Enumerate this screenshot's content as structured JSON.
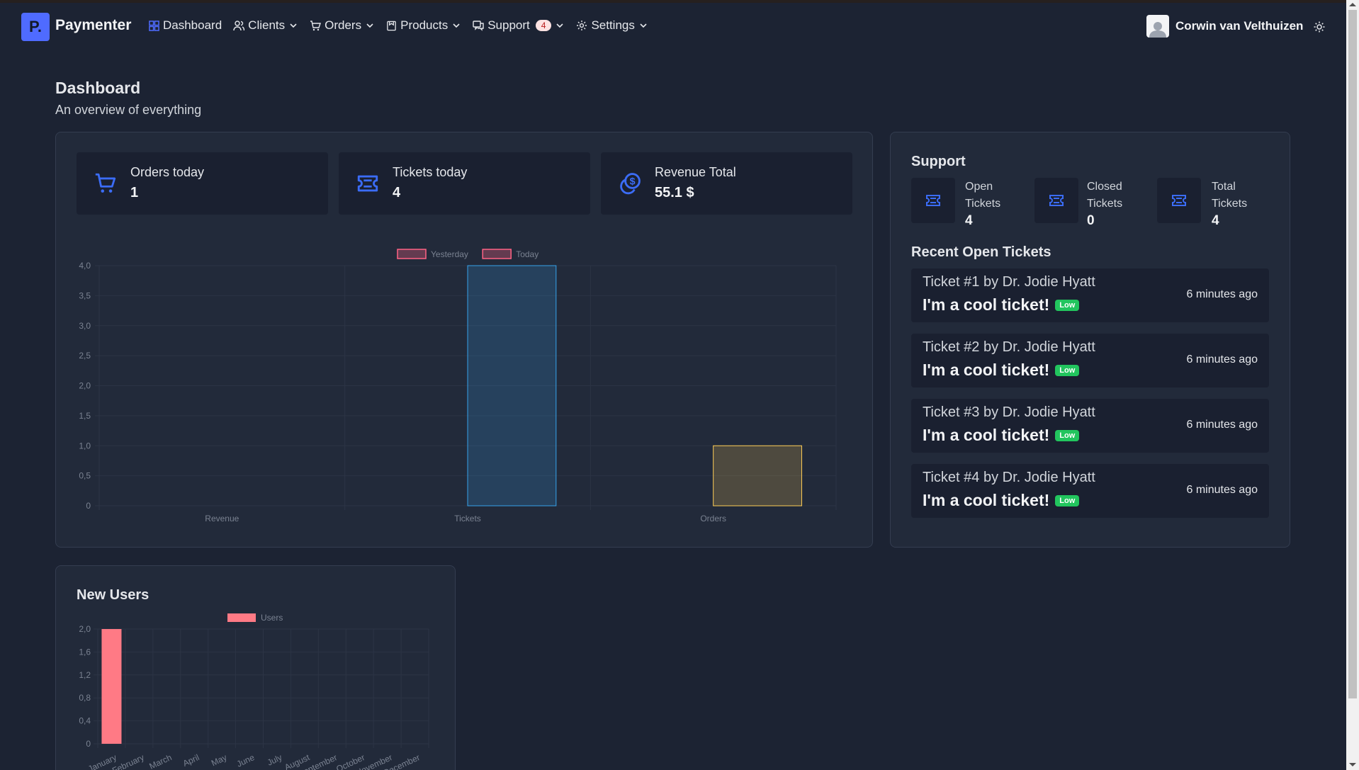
{
  "app": {
    "brand": "Paymenter",
    "logo_letter": "P."
  },
  "nav": {
    "items": [
      {
        "label": "Dashboard",
        "icon": "grid-icon",
        "has_dropdown": false
      },
      {
        "label": "Clients",
        "icon": "users-icon",
        "has_dropdown": true
      },
      {
        "label": "Orders",
        "icon": "cart-icon",
        "has_dropdown": true
      },
      {
        "label": "Products",
        "icon": "box-icon",
        "has_dropdown": true
      },
      {
        "label": "Support",
        "icon": "chat-icon",
        "has_dropdown": true,
        "badge": "4"
      },
      {
        "label": "Settings",
        "icon": "gear-icon",
        "has_dropdown": true
      }
    ],
    "user_name": "Corwin van Velthuizen",
    "theme_icon": "sun-icon"
  },
  "header": {
    "title": "Dashboard",
    "subtitle": "An overview of everything"
  },
  "stats": [
    {
      "label": "Orders today",
      "value": "1",
      "icon": "cart-icon"
    },
    {
      "label": "Tickets today",
      "value": "4",
      "icon": "ticket-icon"
    },
    {
      "label": "Revenue Total",
      "value": "55.1 $",
      "icon": "coins-icon"
    }
  ],
  "support": {
    "title": "Support",
    "open_label": "Open Tickets",
    "open_value": "4",
    "closed_label": "Closed Tickets",
    "closed_value": "0",
    "total_label": "Total Tickets",
    "total_value": "4",
    "recent_title": "Recent Open Tickets",
    "tickets": [
      {
        "title": "Ticket #1 by Dr. Jodie Hyatt",
        "message": "I'm a cool ticket!",
        "priority": "Low",
        "time": "6 minutes ago"
      },
      {
        "title": "Ticket #2 by Dr. Jodie Hyatt",
        "message": "I'm a cool ticket!",
        "priority": "Low",
        "time": "6 minutes ago"
      },
      {
        "title": "Ticket #3 by Dr. Jodie Hyatt",
        "message": "I'm a cool ticket!",
        "priority": "Low",
        "time": "6 minutes ago"
      },
      {
        "title": "Ticket #4 by Dr. Jodie Hyatt",
        "message": "I'm a cool ticket!",
        "priority": "Low",
        "time": "6 minutes ago"
      }
    ]
  },
  "new_users": {
    "title": "New Users"
  },
  "colors": {
    "accent": "#4f6bff",
    "background": "#1c2333",
    "card": "#222a3a",
    "inner": "#1a2030",
    "priority_low": "#22c55e"
  },
  "chart_data": [
    {
      "type": "bar",
      "categories": [
        "Revenue",
        "Tickets",
        "Orders"
      ],
      "series": [
        {
          "name": "Yesterday",
          "values": [
            0,
            0,
            0
          ],
          "color": "#ff6384"
        },
        {
          "name": "Today",
          "values": [
            0,
            4,
            1
          ],
          "colors": [
            "#ff6384",
            "#36a2eb",
            "#ffcd56"
          ]
        }
      ],
      "ylim": [
        0,
        4
      ],
      "yticks": [
        "0",
        "0,5",
        "1,0",
        "1,5",
        "2,0",
        "2,5",
        "3,0",
        "3,5",
        "4,0"
      ],
      "legend": "top",
      "grid": true
    },
    {
      "type": "bar",
      "categories": [
        "January",
        "February",
        "March",
        "April",
        "May",
        "June",
        "July",
        "August",
        "September",
        "October",
        "November",
        "December"
      ],
      "series": [
        {
          "name": "Users",
          "values": [
            2,
            0,
            0,
            0,
            0,
            0,
            0,
            0,
            0,
            0,
            0,
            0
          ],
          "color": "#ff7a85"
        }
      ],
      "ylim": [
        0,
        2
      ],
      "yticks": [
        "0",
        "0,4",
        "0,8",
        "1,2",
        "1,6",
        "2,0"
      ],
      "legend": "top",
      "grid": true
    }
  ]
}
